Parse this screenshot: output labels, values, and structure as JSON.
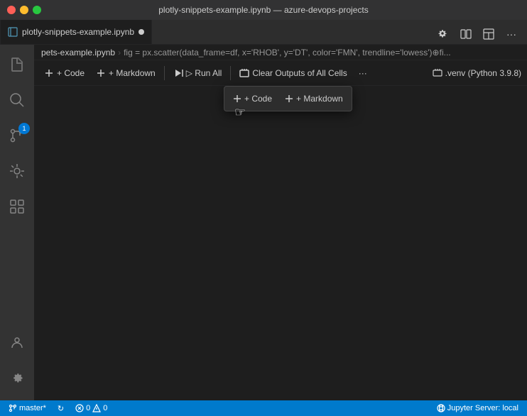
{
  "titleBar": {
    "title": "plotly-snippets-example.ipynb — azure-devops-projects"
  },
  "tab": {
    "filename": "plotly-snippets-example.ipynb",
    "modified": true
  },
  "breadcrumb": {
    "parts": [
      "pets-example.ipynb",
      "fig = px.scatter(data_frame=df, x='RHOB', y='DT', color='FMN', trendline='lowess')⊕fi..."
    ]
  },
  "toolbar": {
    "code_label": "+ Code",
    "markdown_label": "+ Markdown",
    "run_all_label": "▷ Run All",
    "clear_outputs_label": "Clear Outputs of All Cells",
    "more_label": "···",
    "kernel_icon": "■",
    "kernel_label": ".venv (Python 3.9.8)"
  },
  "popup": {
    "code_label": "+ Code",
    "markdown_label": "+ Markdown"
  },
  "statusBar": {
    "branch": "master*",
    "sync_icon": "↻",
    "errors": "0",
    "warnings": "0",
    "jupyter": "Jupyter Server: local"
  },
  "activityBar": {
    "icons": [
      {
        "name": "files-icon",
        "symbol": "⎗",
        "active": false
      },
      {
        "name": "search-icon",
        "symbol": "⌕",
        "active": false
      },
      {
        "name": "source-control-icon",
        "symbol": "⎇",
        "active": false,
        "badge": "1"
      },
      {
        "name": "debug-icon",
        "symbol": "⏵",
        "active": false
      },
      {
        "name": "extensions-icon",
        "symbol": "⊞",
        "active": false
      }
    ],
    "bottomIcons": [
      {
        "name": "accounts-icon",
        "symbol": "◯"
      },
      {
        "name": "settings-icon",
        "symbol": "⚙"
      }
    ]
  }
}
